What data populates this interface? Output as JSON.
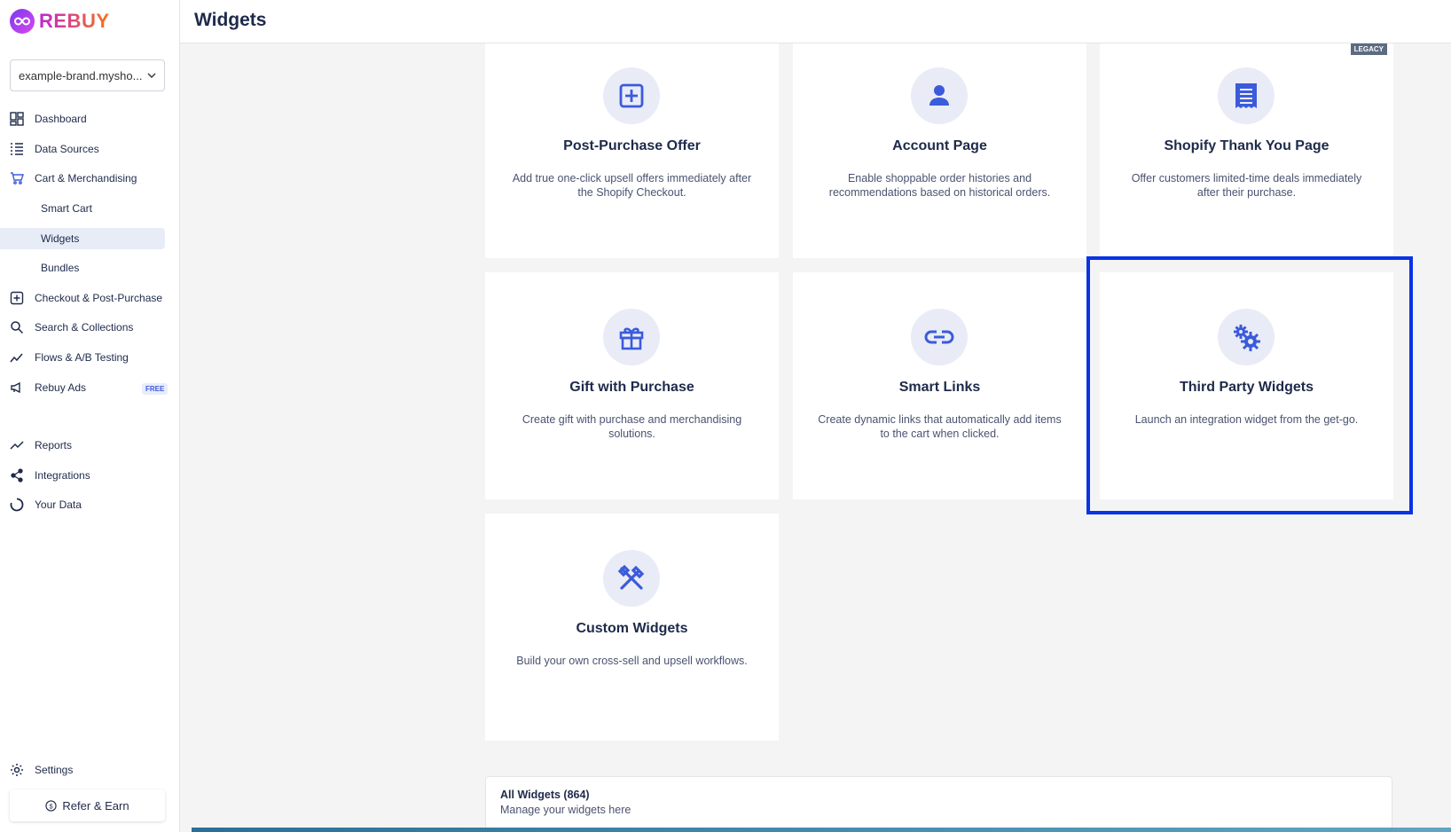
{
  "app": {
    "brand": "REBUY"
  },
  "header": {
    "title": "Widgets"
  },
  "sidebar": {
    "store": "example-brand.mysho...",
    "items": [
      {
        "label": "Dashboard"
      },
      {
        "label": "Data Sources"
      },
      {
        "label": "Cart & Merchandising"
      },
      {
        "label": "Smart Cart"
      },
      {
        "label": "Widgets"
      },
      {
        "label": "Bundles"
      },
      {
        "label": "Checkout & Post-Purchase"
      },
      {
        "label": "Search & Collections"
      },
      {
        "label": "Flows & A/B Testing"
      },
      {
        "label": "Rebuy Ads"
      },
      {
        "label": "Reports"
      },
      {
        "label": "Integrations"
      },
      {
        "label": "Your Data"
      },
      {
        "label": "Settings"
      }
    ],
    "free_badge": "FREE",
    "refer": "Refer & Earn"
  },
  "cards": [
    {
      "title": "Post-Purchase Offer",
      "desc": "Add true one-click upsell offers immediately after the Shopify Checkout."
    },
    {
      "title": "Account Page",
      "desc": "Enable shoppable order histories and recommendations based on historical orders."
    },
    {
      "title": "Shopify Thank You Page",
      "desc": "Offer customers limited-time deals immediately after their purchase.",
      "badge": "LEGACY"
    },
    {
      "title": "Gift with Purchase",
      "desc": "Create gift with purchase and merchandising solutions."
    },
    {
      "title": "Smart Links",
      "desc": "Create dynamic links that automatically add items to the cart when clicked."
    },
    {
      "title": "Third Party Widgets",
      "desc": "Launch an integration widget from the get-go."
    },
    {
      "title": "Custom Widgets",
      "desc": "Build your own cross-sell and upsell workflows."
    }
  ],
  "all_widgets": {
    "title": "All Widgets (864)",
    "subtitle": "Manage your widgets here"
  },
  "colors": {
    "accent": "#3b5bdb",
    "highlight": "#0a32e6",
    "icon_bg": "#e9ecf7"
  }
}
